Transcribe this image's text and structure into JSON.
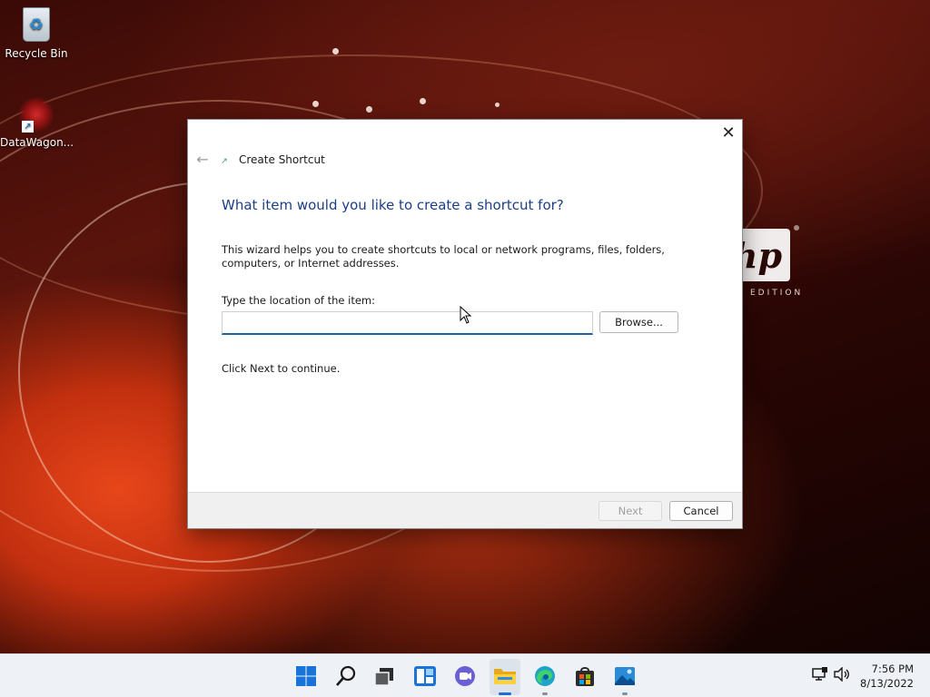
{
  "desktop": {
    "icons": [
      {
        "label": "Recycle Bin",
        "icon": "recycle-bin-icon"
      },
      {
        "label": "DataWagon...",
        "icon": "datawagon-shortcut-icon"
      }
    ],
    "wallpaper_brand": {
      "logo_text": "hp",
      "tagline": "EDITION"
    }
  },
  "dialog": {
    "title": "Create Shortcut",
    "heading": "What item would you like to create a shortcut for?",
    "description": "This wizard helps you to create shortcuts to local or network programs, files, folders, computers, or Internet addresses.",
    "location_label": "Type the location of the item:",
    "location_value": "",
    "browse_label": "Browse...",
    "continue_text": "Click Next to continue.",
    "next_label": "Next",
    "cancel_label": "Cancel",
    "next_enabled": false,
    "accent_color": "#1b3f86"
  },
  "taskbar": {
    "apps": [
      {
        "name": "start",
        "icon": "windows-start-icon"
      },
      {
        "name": "search",
        "icon": "search-icon"
      },
      {
        "name": "task-view",
        "icon": "task-view-icon"
      },
      {
        "name": "widgets",
        "icon": "widgets-icon"
      },
      {
        "name": "chat",
        "icon": "teams-chat-icon"
      },
      {
        "name": "file-explorer",
        "icon": "file-explorer-icon",
        "active": true
      },
      {
        "name": "edge",
        "icon": "edge-browser-icon",
        "running": true
      },
      {
        "name": "store",
        "icon": "microsoft-store-icon"
      },
      {
        "name": "photos",
        "icon": "photos-icon",
        "running": true
      }
    ],
    "tray": {
      "network_icon": "network-icon",
      "volume_icon": "volume-icon"
    },
    "clock": {
      "time": "7:56 PM",
      "date": "8/13/2022"
    }
  }
}
